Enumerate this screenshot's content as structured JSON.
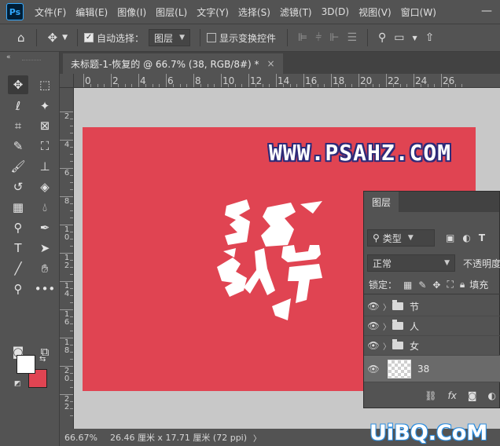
{
  "app": {
    "logo": "Ps"
  },
  "menu": [
    "文件(F)",
    "编辑(E)",
    "图像(I)",
    "图层(L)",
    "文字(Y)",
    "选择(S)",
    "滤镜(T)",
    "3D(D)",
    "视图(V)",
    "窗口(W)"
  ],
  "window": {
    "minimize": "—"
  },
  "options_bar": {
    "home_icon": "home-icon",
    "move_icon": "move-icon",
    "auto_select_label": "自动选择：",
    "auto_select_checked": true,
    "target_value": "图层",
    "show_transform_label": "显示变换控件",
    "show_transform_checked": false
  },
  "document": {
    "tab_title": "未标题-1-恢复的 @ 66.7% (38, RGB/8#) *",
    "close": "×",
    "canvas_color": "#e04452",
    "watermark": "WWW.PSAHZ.COM"
  },
  "ruler": {
    "h_labels": [
      "0",
      "2",
      "4",
      "6",
      "8",
      "10",
      "12",
      "14",
      "16",
      "18",
      "20",
      "22",
      "24",
      "26"
    ],
    "v_labels": [
      "2",
      "4",
      "6",
      "8",
      "1\n0",
      "1\n2",
      "1\n4",
      "1\n6",
      "1\n8",
      "2\n0",
      "2\n2"
    ]
  },
  "colors": {
    "foreground": "#ffffff",
    "background": "#e04452"
  },
  "status": {
    "zoom": "66.67%",
    "info": "26.46 厘米 x 17.71 厘米 (72 ppi)",
    "more": "〉"
  },
  "layers_panel": {
    "tab": "图层",
    "filter_value": "类型",
    "blend_mode": "正常",
    "opacity_label": "不透明度",
    "lock_label": "锁定：",
    "fill_label": "填充",
    "layers": [
      {
        "name": "节",
        "type": "group"
      },
      {
        "name": "人",
        "type": "group"
      },
      {
        "name": "女",
        "type": "group"
      },
      {
        "name": "38",
        "type": "pixel",
        "selected": true
      }
    ]
  },
  "site_mark": "UiBQ.CoM"
}
